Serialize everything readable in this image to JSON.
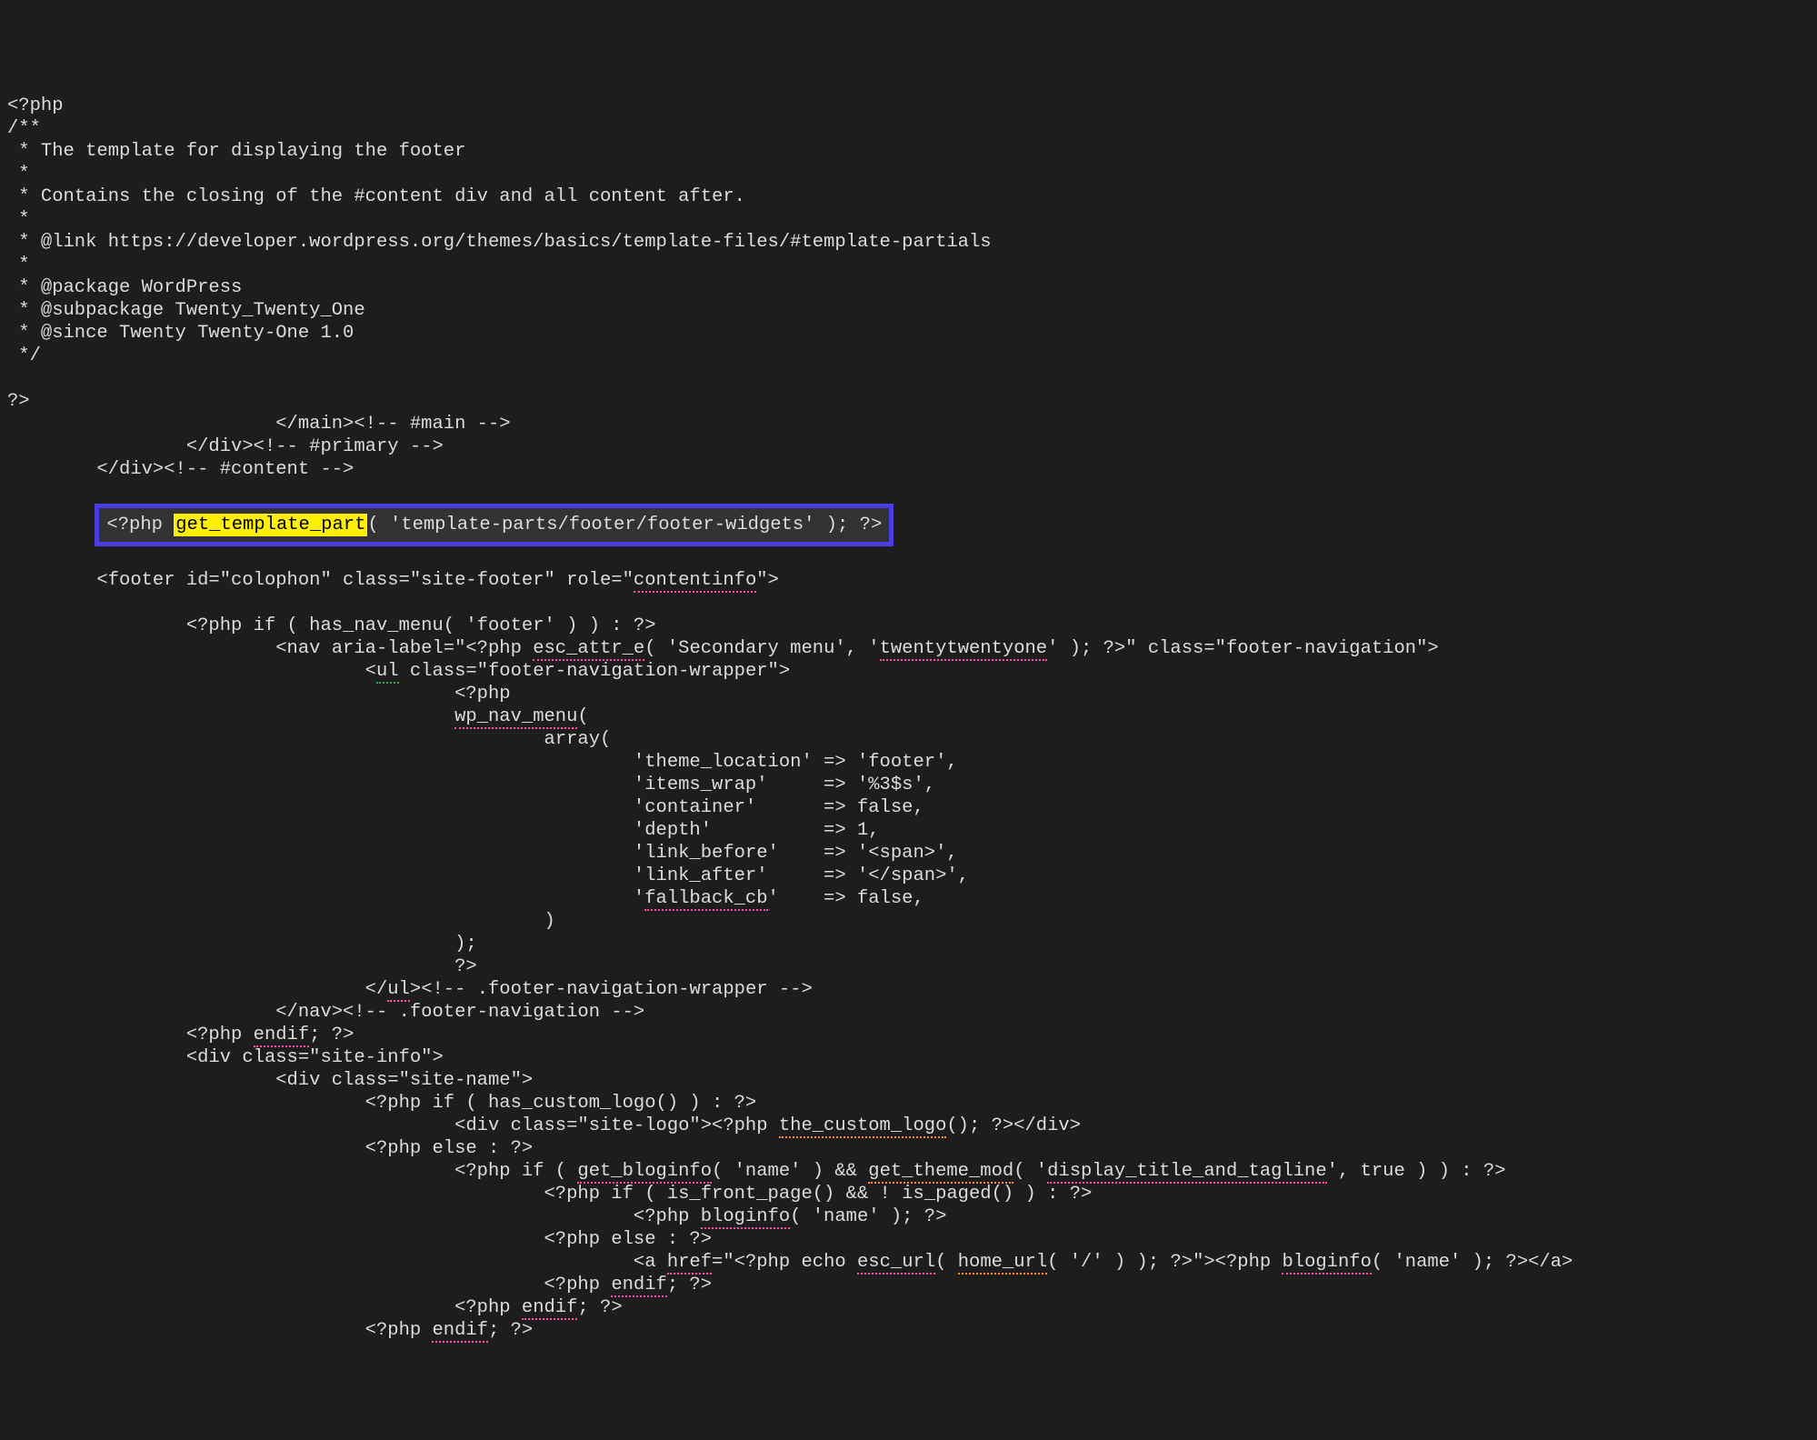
{
  "lines": {
    "l01": "<?php",
    "l02": "/**",
    "l03": " * The template for displaying the footer",
    "l04": " *",
    "l05": " * Contains the closing of the #content div and all content after.",
    "l06": " *",
    "l07": " * @link https://developer.wordpress.org/themes/basics/template-files/#template-partials",
    "l08": " *",
    "l09": " * @package WordPress",
    "l10": " * @subpackage Twenty_Twenty_One",
    "l11": " * @since Twenty Twenty-One 1.0",
    "l12": " */",
    "l14": "?>",
    "l15": "                        </main><!-- #main -->",
    "l16": "                </div><!-- #primary -->",
    "l17": "        </div><!-- #content -->"
  },
  "hl": {
    "pre": "<?php ",
    "fn": "get_template_part",
    "post": "( 'template-parts/footer/footer-widgets' ); ?>"
  },
  "after": {
    "a01a": "        <footer id=\"colophon\" class=\"site-footer\" role=\"",
    "a01b": "contentinfo",
    "a01c": "\">",
    "a02": "                <?php if ( has_nav_menu( 'footer' ) ) : ?>",
    "a03a": "                        <nav aria-label=\"<?php ",
    "a03b": "esc_attr_e",
    "a03c": "( 'Secondary menu', '",
    "a03d": "twentytwentyone",
    "a03e": "' ); ?>\" class=\"footer-navigation\">",
    "a04a": "                                <",
    "a04b": "ul",
    "a04c": " class=\"footer-navigation-wrapper\">",
    "a05": "                                        <?php",
    "a06a": "                                        ",
    "a06b": "wp_nav_menu",
    "a06c": "(",
    "a07": "                                                array(",
    "a08": "                                                        'theme_location' => 'footer',",
    "a09": "                                                        'items_wrap'     => '%3$s',",
    "a10": "                                                        'container'      => false,",
    "a11": "                                                        'depth'          => 1,",
    "a12": "                                                        'link_before'    => '<span>',",
    "a13": "                                                        'link_after'     => '</span>',",
    "a14a": "                                                        '",
    "a14b": "fallback_cb",
    "a14c": "'    => false,",
    "a15": "                                                )",
    "a16": "                                        );",
    "a17": "                                        ?>",
    "a18a": "                                </",
    "a18b": "ul",
    "a18c": "><!-- .footer-navigation-wrapper -->",
    "a19": "                        </nav><!-- .footer-navigation -->",
    "a20a": "                <?php ",
    "a20b": "endif",
    "a20c": "; ?>",
    "a21": "                <div class=\"site-info\">",
    "a22": "                        <div class=\"site-name\">",
    "a23": "                                <?php if ( has_custom_logo() ) : ?>",
    "a24a": "                                        <div class=\"site-logo\"><?php ",
    "a24b": "the_custom_logo",
    "a24c": "(); ?></div>",
    "a25": "                                <?php else : ?>",
    "a26a": "                                        <?php if ( ",
    "a26b": "get_bloginfo",
    "a26c": "( 'name' ) && ",
    "a26d": "get_theme_mod",
    "a26e": "( '",
    "a26f": "display_title_and_tagline",
    "a26g": "', true ) ) : ?>",
    "a27": "                                                <?php if ( is_front_page() && ! is_paged() ) : ?>",
    "a28a": "                                                        <?php ",
    "a28b": "bloginfo",
    "a28c": "( 'name' ); ?>",
    "a29": "                                                <?php else : ?>",
    "a30a": "                                                        <a ",
    "a30b": "href",
    "a30c": "=\"<?php echo ",
    "a30d": "esc_url",
    "a30e": "( ",
    "a30f": "home_url",
    "a30g": "( '/' ) ); ?>\"><?php ",
    "a30h": "bloginfo",
    "a30i": "( 'name' ); ?></a>",
    "a31a": "                                                <?php ",
    "a31b": "endif",
    "a31c": "; ?>",
    "a32a": "                                        <?php ",
    "a32b": "endif",
    "a32c": "; ?>",
    "a33a": "                                <?php ",
    "a33b": "endif",
    "a33c": "; ?>"
  }
}
